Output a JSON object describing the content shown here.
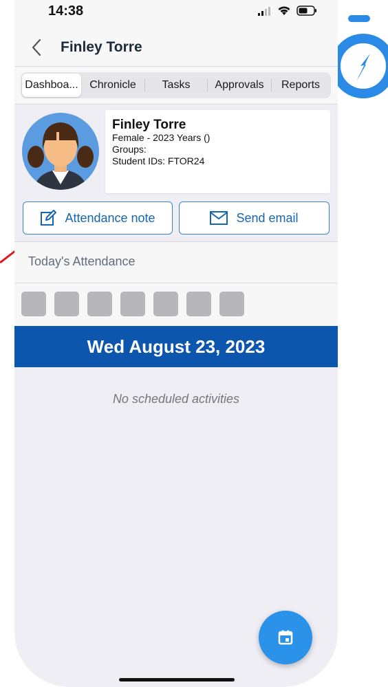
{
  "status_bar": {
    "time": "14:38"
  },
  "header": {
    "title": "Finley Torre"
  },
  "tabs": [
    {
      "label": "Dashboa...",
      "active": true
    },
    {
      "label": "Chronicle",
      "active": false
    },
    {
      "label": "Tasks",
      "active": false
    },
    {
      "label": "Approvals",
      "active": false
    },
    {
      "label": "Reports",
      "active": false
    }
  ],
  "profile": {
    "name": "Finley Torre",
    "details": "Female - 2023 Years ()",
    "groups": "Groups:",
    "student_ids": "Student IDs: FTOR24"
  },
  "actions": {
    "attendance_note": "Attendance note",
    "send_email": "Send email"
  },
  "attendance": {
    "title": "Today's Attendance",
    "slot_count": 7
  },
  "schedule": {
    "date": "Wed August 23, 2023",
    "empty_message": "No scheduled activities"
  },
  "colors": {
    "accent": "#0c56ad",
    "button_text": "#1565b0",
    "fab": "#2a93e9",
    "logo": "#2b8ae6",
    "annotation_arrow": "#e5141b"
  },
  "icons": {
    "back": "chevron-left-icon",
    "attendance_note": "edit-note-icon",
    "send_email": "mail-icon",
    "fab": "calendar-icon"
  }
}
